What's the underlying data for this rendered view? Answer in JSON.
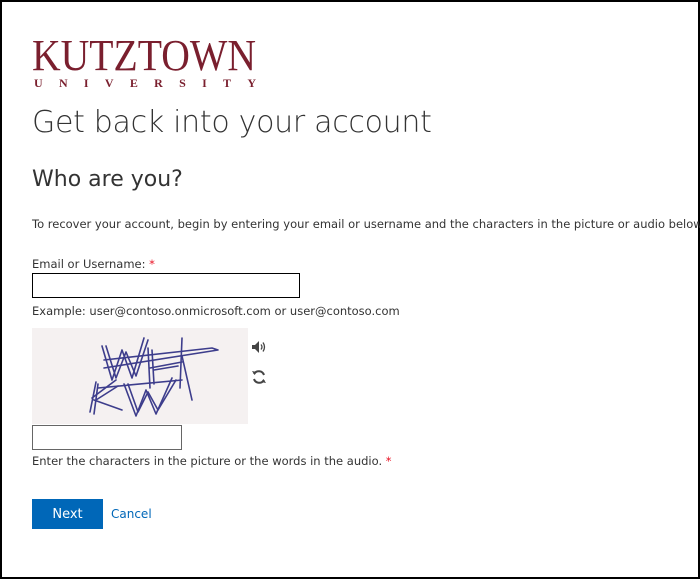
{
  "logo": {
    "main": "Kutztown",
    "sub": "UNIVERSITY"
  },
  "page_title": "Get back into your account",
  "section_title": "Who are you?",
  "instructions": "To recover your account, begin by entering your email or username and the characters in the picture or audio below.",
  "email_field": {
    "label": "Email or Username:",
    "required_mark": "*",
    "value": "",
    "placeholder": ""
  },
  "example_text": "Example: user@contoso.onmicrosoft.com or user@contoso.com",
  "captcha": {
    "image_text": "WHKW",
    "audio_icon": "speaker-icon",
    "refresh_icon": "refresh-icon",
    "input_value": "",
    "hint": "Enter the characters in the picture or the words in the audio.",
    "required_mark": "*"
  },
  "actions": {
    "next_label": "Next",
    "cancel_label": "Cancel"
  },
  "colors": {
    "brand": "#7a1f2e",
    "primary_button": "#0067b8",
    "link": "#0067b8",
    "required": "#e81123"
  }
}
